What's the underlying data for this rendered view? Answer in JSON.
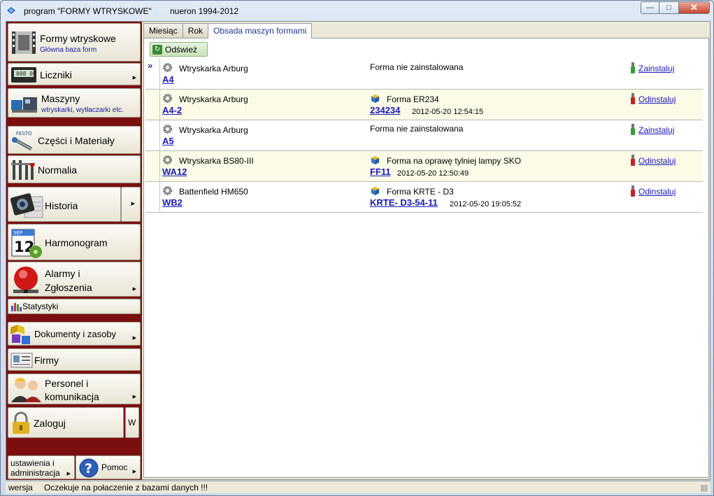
{
  "window": {
    "title": "program \"FORMY WTRYSKOWE\"",
    "copyright": "nueron 1994-2012",
    "controls": {
      "minimize": "—",
      "maximize": "□",
      "close": "✕"
    }
  },
  "sidebar": {
    "formy": {
      "label": "Formy wtryskowe",
      "sub": "Główna baza form"
    },
    "liczniki": {
      "label": "Liczniki"
    },
    "maszyny": {
      "label": "Maszyny",
      "sub": "wtryskarki, wytłaczarki etc."
    },
    "czesci": {
      "label": "Części i Materiały"
    },
    "normalia": {
      "label": "Normalia"
    },
    "historia": {
      "label": "Historia"
    },
    "harmonogram": {
      "label": "Harmonogram",
      "icon_text_month": "SEP",
      "icon_text_day": "12"
    },
    "alarmy": {
      "label": "Alarmy i Zgłoszenia"
    },
    "statystyki": {
      "label": "Statystyki"
    },
    "dokumenty": {
      "label": "Dokumenty i zasoby"
    },
    "firmy": {
      "label": "Firmy"
    },
    "personel": {
      "label": "Personel i komunikacja"
    },
    "zaloguj": {
      "label": "Zaloguj",
      "side": "W"
    },
    "ustawienia": {
      "label": "ustawienia i administracja"
    },
    "pomoc": {
      "label": "Pomoc"
    }
  },
  "tabs": [
    {
      "label": "Miesiąc",
      "active": false
    },
    {
      "label": "Rok",
      "active": false
    },
    {
      "label": "Obsada maszyn formami",
      "active": true
    }
  ],
  "toolbar": {
    "refresh_label": "Odśwież"
  },
  "rows": [
    {
      "machine": "Wtryskarka Arburg",
      "code": "A4",
      "form": "Forma nie zainstalowana",
      "form_code": "",
      "date": "",
      "action": "Zainstaluj",
      "current": true
    },
    {
      "machine": "Wtryskarka Arburg",
      "code": "A4-2",
      "form": "Forma ER234",
      "form_code": "234234",
      "date": "2012-05-20 12:54:15",
      "action": "Odinstaluj",
      "current": false
    },
    {
      "machine": "Wtryskarka Arburg",
      "code": "A5",
      "form": "Forma nie zainstalowana",
      "form_code": "",
      "date": "",
      "action": "Zainstaluj",
      "current": false
    },
    {
      "machine": "Wtryskarka BS80-III",
      "code": "WA12",
      "form": "Forma na oprawę tylniej lampy SKO",
      "form_code": "FF11",
      "date": "2012-05-20 12:50:49",
      "action": "Odinstaluj",
      "current": false
    },
    {
      "machine": "Battenfield HM650",
      "code": "WB2",
      "form": "Forma  KRTE - D3",
      "form_code": "KRTE- D3-54-11",
      "date": "2012-05-20 19:05:52",
      "action": "Odinstaluj",
      "current": false
    }
  ],
  "statusbar": {
    "version": "wersja",
    "message": "Oczekuje na połaczenie z bazami danych !!!"
  },
  "colors": {
    "sidebar_bg": "#7b0f10",
    "link": "#1a1ab8",
    "row_alt": "#fbfbe8"
  }
}
